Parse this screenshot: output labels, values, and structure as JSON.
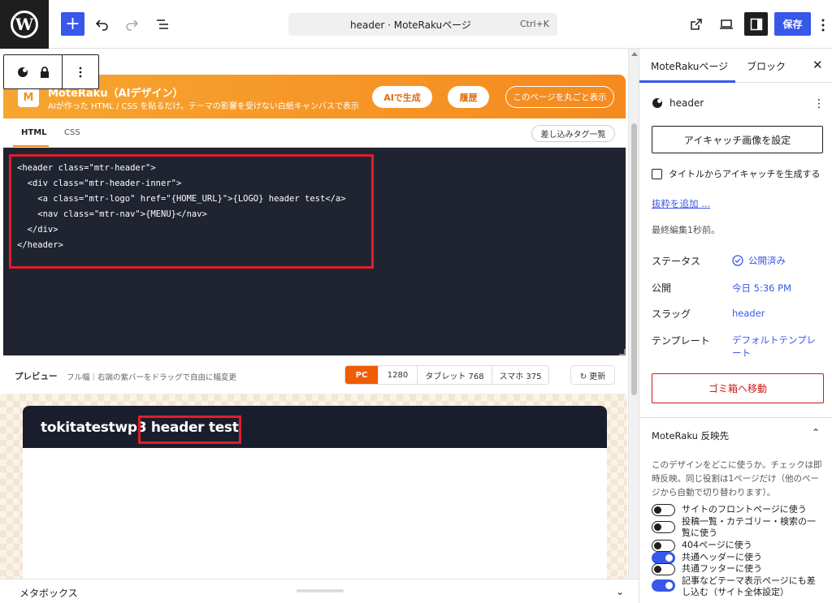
{
  "topbar": {
    "logo_letter": "W",
    "document_title": "header · MoteRakuページ",
    "shortcut": "Ctrl+K",
    "save_label": "保存"
  },
  "plugin": {
    "logo_letter": "M",
    "name": "MoteRaku（AIデザイン）",
    "description": "AIが作った HTML / CSS を貼るだけ。テーマの影響を受けない白紙キャンバスで表示",
    "ai_button": "AIで生成",
    "history_button": "履歴",
    "full_view_button": "このページを丸ごと表示",
    "tabs": [
      "HTML",
      "CSS"
    ],
    "tag_list_button": "差し込みタグ一覧"
  },
  "code": {
    "lines": [
      "<header class=\"mtr-header\">",
      "  <div class=\"mtr-header-inner\">",
      "    <a class=\"mtr-logo\" href=\"{HOME_URL}\">{LOGO} header test</a>",
      "    <nav class=\"mtr-nav\">{MENU}</nav>",
      "  </div>",
      "</header>"
    ]
  },
  "preview": {
    "label": "プレビュー",
    "hint": "フル幅｜右端の紫バーをドラッグで自由に幅変更",
    "sizes": [
      "PC",
      "1280",
      "タブレット 768",
      "スマホ 375"
    ],
    "active_size": "PC",
    "refresh_button": "↻ 更新",
    "site_logo_prefix": "tokitatestwp3",
    "site_logo_highlight": " header test"
  },
  "metabox": {
    "label": "メタボックス"
  },
  "sidebar": {
    "tabs": [
      "MoteRakuページ",
      "ブロック"
    ],
    "post_name": "header",
    "featured_button": "アイキャッチ画像を設定",
    "generate_checkbox": "タイトルからアイキャッチを生成する",
    "excerpt_link": "抜粋を追加 ...",
    "last_edited": "最終編集1秒前。",
    "rows": [
      {
        "label": "ステータス",
        "value": "公開済み"
      },
      {
        "label": "公開",
        "value": "今日 5:36 PM"
      },
      {
        "label": "スラッグ",
        "value": "header"
      },
      {
        "label": "テンプレート",
        "value": "デフォルトテンプレート"
      }
    ],
    "trash_button": "ゴミ箱へ移動",
    "section_title": "MoteRaku 反映先",
    "section_desc": "このデザインをどこに使うか。チェックは即時反映。同じ役割は1ページだけ（他のページから自動で切り替わります）。",
    "toggles": [
      {
        "label": "サイトのフロントページに使う",
        "on": false
      },
      {
        "label": "投稿一覧・カテゴリー・検索の一覧に使う",
        "on": false
      },
      {
        "label": "404ページに使う",
        "on": false
      },
      {
        "label": "共通ヘッダーに使う",
        "on": true
      },
      {
        "label": "共通フッターに使う",
        "on": false
      },
      {
        "label": "記事などテーマ表示ページにも差し込む（サイト全体設定）",
        "on": true
      }
    ]
  },
  "colors": {
    "accent": "#3858e9",
    "orange": "#f58a1f",
    "highlight_red": "#e11d2a",
    "code_bg": "#1f2430"
  }
}
